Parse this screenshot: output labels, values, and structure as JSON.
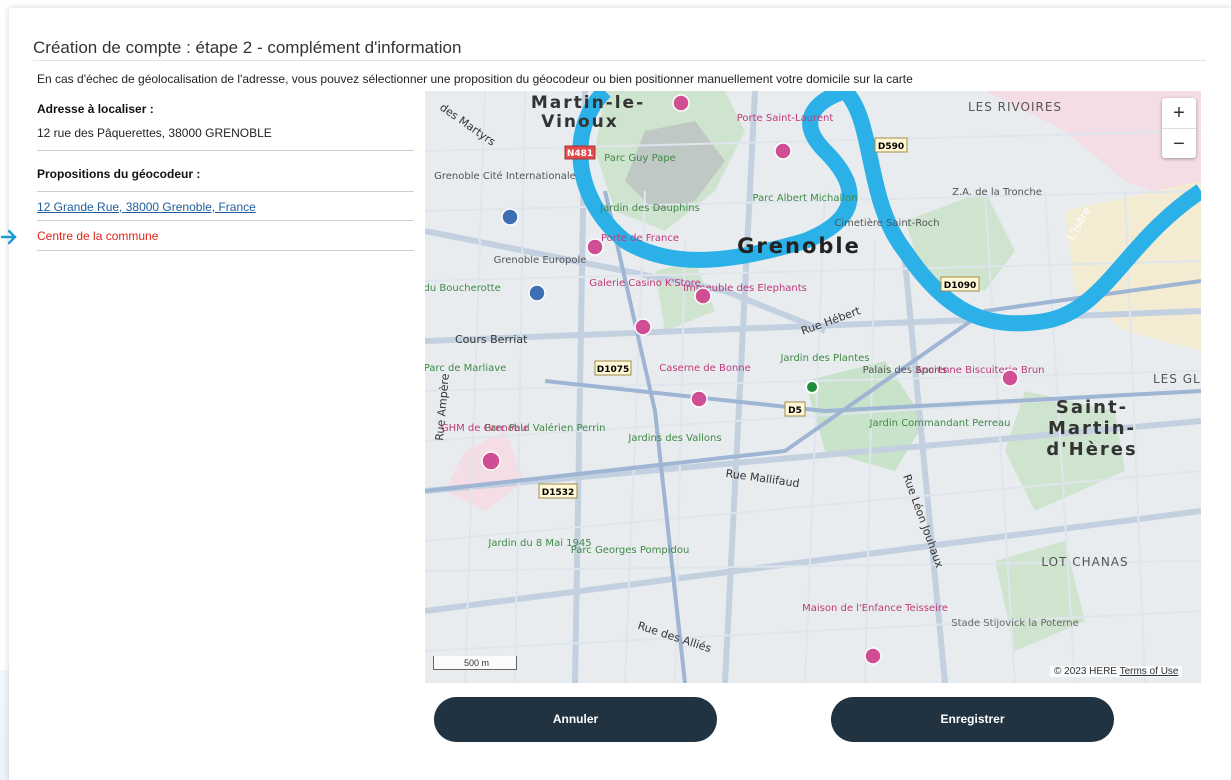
{
  "page": {
    "title": "Création de compte : étape 2 - complément d'information",
    "intro": "En cas d'échec de géolocalisation de l'adresse, vous pouvez sélectionner une proposition du géocodeur ou bien positionner manuellement votre domicile sur la carte"
  },
  "address": {
    "label": "Adresse à localiser :",
    "value": "12 rue des Pâquerettes, 38000 GRENOBLE"
  },
  "geocoder": {
    "label": "Propositions du géocodeur :",
    "suggestion": "12 Grande Rue, 38000 Grenoble, France",
    "fallback": "Centre de la commune"
  },
  "map": {
    "zoom_in": "+",
    "zoom_out": "−",
    "scale": "500 m",
    "copyright": "© 2023 HERE",
    "terms": "Terms of Use",
    "labels": {
      "martin_le": "Martin-le-",
      "vinoux": "Vinoux",
      "grenoble": "Grenoble",
      "les_rivoires": "LES RIVOIRES",
      "saint": "Saint-",
      "martin": "Martin-",
      "dheres": "d'Hères",
      "lot_chanas": "LOT CHANAS",
      "les_gl": "LES GL",
      "cours_berriat": "Cours Berriat",
      "rue_hebert": "Rue Hébert",
      "rue_mallifaud": "Rue Mallifaud",
      "rue_des_allies": "Rue des Alliés",
      "rue_ampere": "Rue Ampère",
      "rue_leon_jouhaux": "Rue Léon Jouhaux",
      "rue_des_martyrs": "des Martyrs",
      "jardin_des_plantes": "Jardin des Plantes",
      "palais_des_sports": "Palais des Sports",
      "cimetiere": "Cimetière Saint-Roch",
      "parc_albert": "Parc Albert Michallon",
      "jardin_dauphins": "Jardin des Dauphins",
      "parc_guy_pape": "Parc Guy Pape",
      "porte_france": "Porte de France",
      "porte_saint_laurent": "Porte Saint-Laurent",
      "galerie": "Galerie Casino K'Store",
      "immeuble": "Immeuble des Elephants",
      "caserne": "Caserne de Bonne",
      "jardins_vallons": "Jardins des Vallons",
      "parc_marliave": "Parc de Marliave",
      "parc_paul": "Parc Paul Valérien Perrin",
      "ghm": "GHM de Grenoble",
      "jardin_8mai": "Jardin du 8 Mai 1945",
      "parc_pompidou": "Parc Georges Pompidou",
      "maison_enfance": "Maison de l'Enfance Teisseire",
      "stade": "Stade Stijovick la Poterne",
      "jardin_commandant": "Jardin Commandant Perreau",
      "ancienne_biscuiterie": "Ancienne Biscuiterie Brun",
      "za_tronche": "Z.A. de la Tronche",
      "grenoble_cite": "Grenoble Cité Internationale",
      "grenoble_europole": "Grenoble Europole",
      "parc_bouchayer": "Parc du Boucherotte",
      "isere": "L'Isère",
      "d1075": "D1075",
      "d1532": "D1532",
      "d1090": "D1090",
      "d590": "D590",
      "d5": "D5",
      "n481": "N481"
    }
  },
  "buttons": {
    "cancel": "Annuler",
    "save": "Enregistrer"
  },
  "colors": {
    "button_bg": "#213340",
    "link": "#1f5e9c",
    "alert": "#e2231a",
    "marker": "#1e8c3a",
    "river": "#2bb1e8"
  }
}
